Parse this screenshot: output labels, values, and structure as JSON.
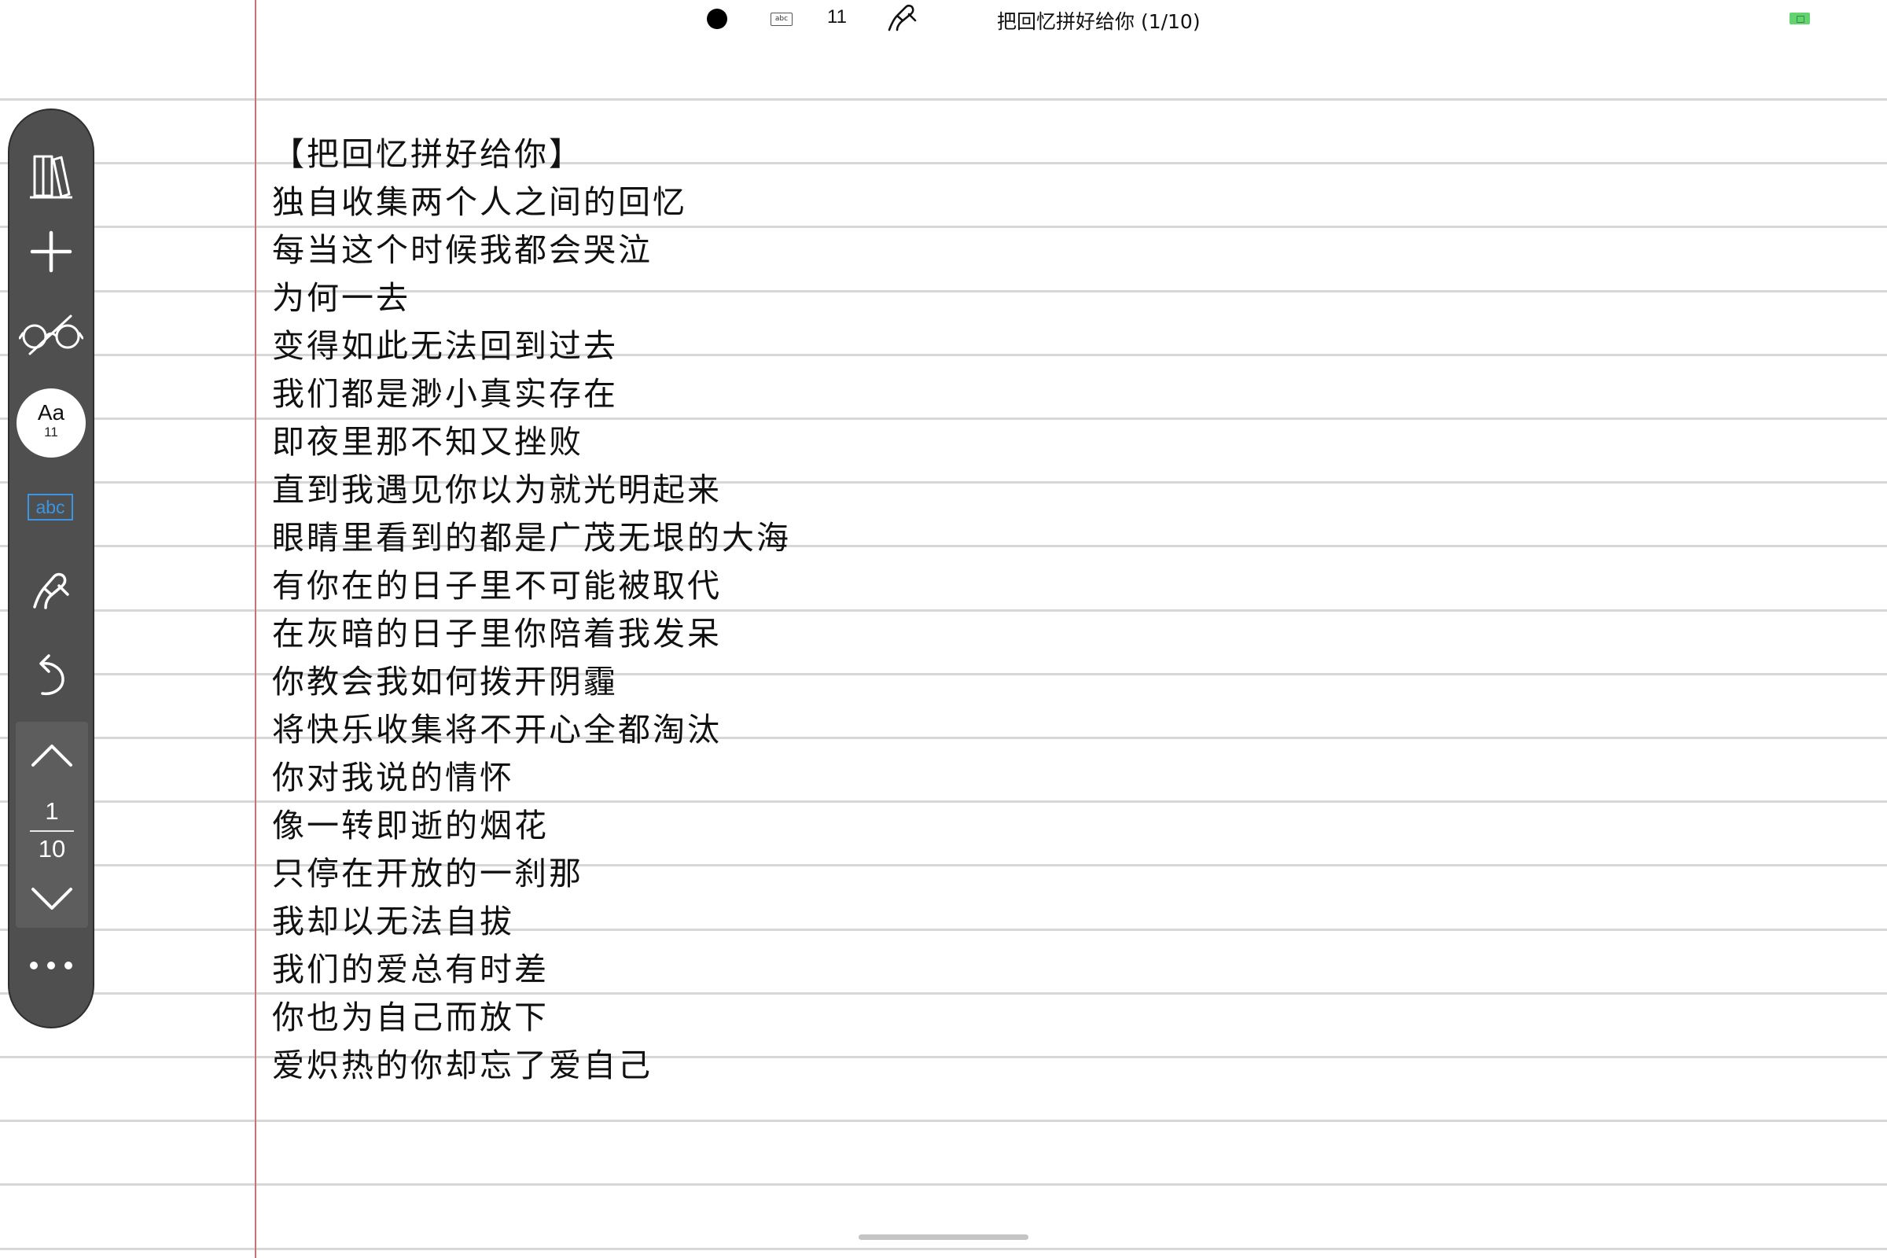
{
  "status_bar": {
    "font_size": "11",
    "abc_badge": "abc",
    "document_title": "把回忆拼好给你 (1/10)",
    "icons": [
      "ink-color-dot-icon",
      "abc-icon",
      "pen-icon",
      "battery-icon"
    ]
  },
  "toolbar": {
    "icons": [
      "library-icon",
      "plus-icon",
      "glasses-icon",
      "font-icon",
      "abc-icon",
      "pen-icon",
      "undo-icon",
      "chevron-up-icon",
      "chevron-down-icon",
      "more-icon"
    ],
    "font_button": {
      "label": "Aa",
      "size": "11"
    },
    "abc_label": "abc",
    "pager": {
      "current": "1",
      "total": "10"
    },
    "accent_color": "#3b95e0",
    "background_color": "#4f4f4f"
  },
  "lyrics": [
    "【把回忆拼好给你】",
    "独自收集两个人之间的回忆",
    "每当这个时候我都会哭泣",
    "为何一去",
    "变得如此无法回到过去",
    "我们都是渺小真实存在",
    "即夜里那不知又挫败",
    "直到我遇见你以为就光明起来",
    "眼睛里看到的都是广茂无垠的大海",
    "有你在的日子里不可能被取代",
    "在灰暗的日子里你陪着我发呆",
    "你教会我如何拨开阴霾",
    "将快乐收集将不开心全都淘汰",
    "你对我说的情怀",
    "像一转即逝的烟花",
    "只停在开放的一刹那",
    "我却以无法自拔",
    "我们的爱总有时差",
    "你也为自己而放下",
    "爱炽热的你却忘了爱自己"
  ]
}
